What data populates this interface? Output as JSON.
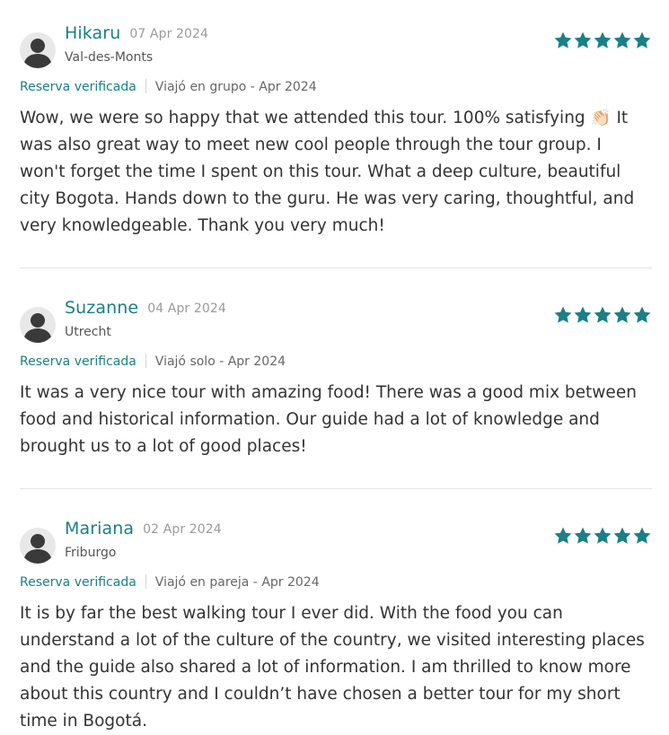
{
  "colors": {
    "accent": "#1a7f86",
    "star": "#1a7f86",
    "muted": "#9a9a9a"
  },
  "reviews": [
    {
      "name": "Hikaru",
      "date": "07 Apr 2024",
      "city": "Val-des-Monts",
      "rating": 5,
      "verified": "Reserva verificada",
      "trip": "Viajó en grupo - Apr 2024",
      "text": "Wow, we were so happy that we attended this tour. 100% satisfying 👏🏻 It was also great way to meet new cool people through the tour group. I won't forget the time I spent on this tour. What a deep culture, beautiful city Bogota. Hands down to the guru. He was very caring, thoughtful, and very knowledgeable. Thank you very much!"
    },
    {
      "name": "Suzanne",
      "date": "04 Apr 2024",
      "city": "Utrecht",
      "rating": 5,
      "verified": "Reserva verificada",
      "trip": "Viajó solo - Apr 2024",
      "text": "It was a very nice tour with amazing food! There was a good mix between food and historical information. Our guide had a lot of knowledge and brought us to a lot of good places!"
    },
    {
      "name": "Mariana",
      "date": "02 Apr 2024",
      "city": "Friburgo",
      "rating": 5,
      "verified": "Reserva verificada",
      "trip": "Viajó en pareja - Apr 2024",
      "text": "It is by far the best walking tour I ever did. With the food you can understand a lot of the culture of the country, we visited interesting places and the guide also shared a lot of information. I am thrilled to know more about this country and I couldn’t have chosen a better tour for my short time in Bogotá."
    }
  ]
}
